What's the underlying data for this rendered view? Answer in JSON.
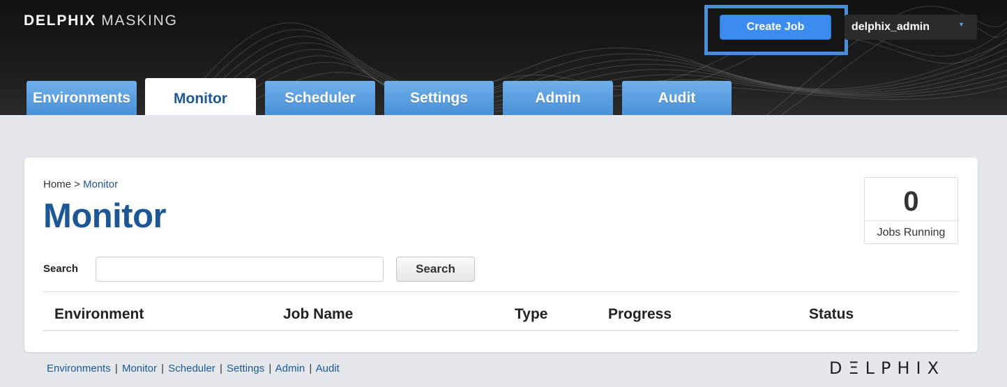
{
  "header": {
    "logo_bold": "DELPHIX",
    "logo_light": "MASKING",
    "create_job_label": "Create Job",
    "user_name": "delphix_admin",
    "user_caret": "▼"
  },
  "tabs": [
    {
      "label": "Environments",
      "active": false
    },
    {
      "label": "Monitor",
      "active": true
    },
    {
      "label": "Scheduler",
      "active": false
    },
    {
      "label": "Settings",
      "active": false
    },
    {
      "label": "Admin",
      "active": false
    },
    {
      "label": "Audit",
      "active": false
    }
  ],
  "breadcrumb": {
    "home": "Home",
    "separator": " > ",
    "current": "Monitor"
  },
  "page": {
    "title": "Monitor"
  },
  "jobs": {
    "count": "0",
    "label": "Jobs Running"
  },
  "search": {
    "label": "Search",
    "value": "",
    "placeholder": "",
    "button_label": "Search"
  },
  "table": {
    "columns": [
      "Environment",
      "Job Name",
      "Type",
      "Progress",
      "Status"
    ],
    "rows": []
  },
  "footer": {
    "links": [
      "Environments",
      "Monitor",
      "Scheduler",
      "Settings",
      "Admin",
      "Audit"
    ],
    "separator": "|",
    "brand": "DΞLPHIX"
  },
  "colors": {
    "accent": "#1d5796",
    "tab_blue": "#4990d6",
    "create_button": "#3c8cf0",
    "highlight_frame": "#4a8ed8"
  }
}
